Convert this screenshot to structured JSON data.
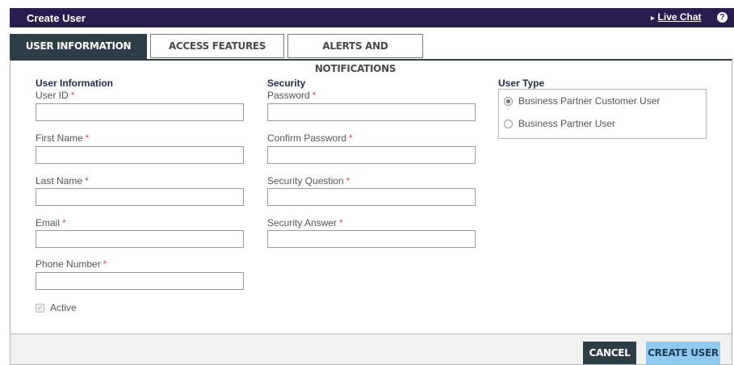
{
  "header": {
    "title": "Create User",
    "live_chat_arrow": "▸",
    "live_chat_label": "Live Chat",
    "help_icon": "?"
  },
  "tabs": [
    {
      "label": "USER INFORMATION",
      "active": true
    },
    {
      "label": "ACCESS FEATURES",
      "active": false
    },
    {
      "label": "ALERTS AND NOTIFICATIONS",
      "active": false
    }
  ],
  "user_info": {
    "section_title": "User Information",
    "fields": [
      {
        "label": "User ID",
        "required": "*",
        "value": ""
      },
      {
        "label": "First Name",
        "required": "*",
        "value": ""
      },
      {
        "label": "Last Name",
        "required": "*",
        "value": ""
      },
      {
        "label": "Email",
        "required": "*",
        "value": ""
      },
      {
        "label": "Phone Number",
        "required": "*",
        "value": ""
      }
    ],
    "active_label": "Active",
    "active_checked": true
  },
  "security": {
    "section_title": "Security",
    "fields": [
      {
        "label": "Password",
        "required": "*",
        "value": ""
      },
      {
        "label": "Confirm Password",
        "required": "*",
        "value": ""
      },
      {
        "label": "Security Question",
        "required": "*",
        "value": ""
      },
      {
        "label": "Security Answer",
        "required": "*",
        "value": ""
      }
    ]
  },
  "user_type": {
    "section_title": "User Type",
    "options": [
      {
        "label": "Business Partner Customer User",
        "selected": true
      },
      {
        "label": "Business Partner User",
        "selected": false
      }
    ]
  },
  "footer": {
    "cancel_label": "CANCEL",
    "create_label": "CREATE USER"
  },
  "colors": {
    "header_bg": "#2b1c4f",
    "active_tab_bg": "#2e3e47",
    "required": "#e0463b",
    "create_button_bg": "#8fcaf0"
  }
}
